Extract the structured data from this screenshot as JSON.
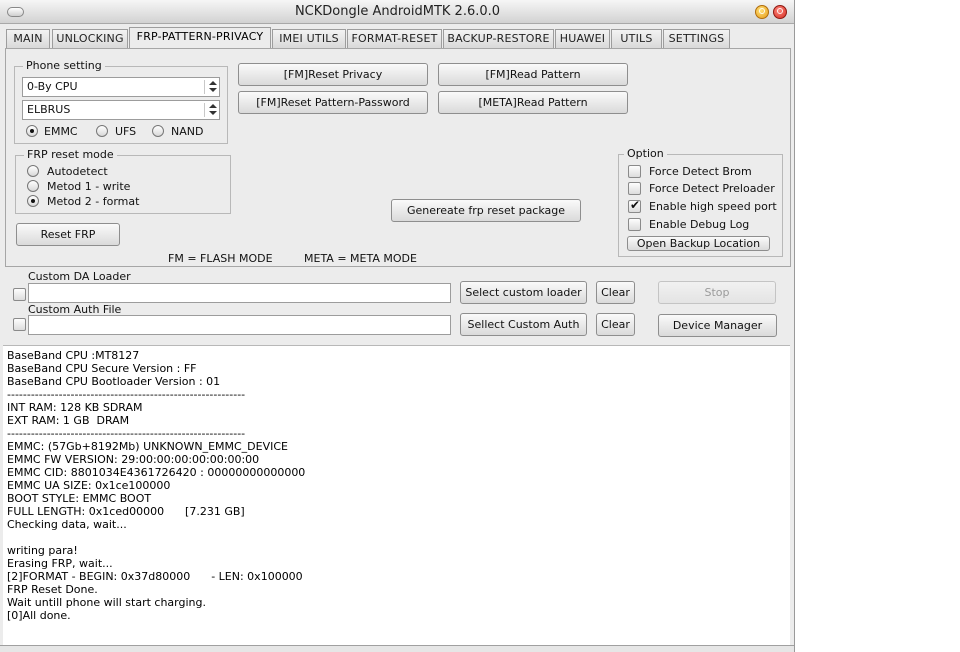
{
  "window": {
    "title": "NCKDongle AndroidMTK 2.6.0.0"
  },
  "tabs": [
    {
      "label": "MAIN"
    },
    {
      "label": "UNLOCKING"
    },
    {
      "label": "FRP-PATTERN-PRIVACY"
    },
    {
      "label": "IMEI UTILS"
    },
    {
      "label": "FORMAT-RESET"
    },
    {
      "label": "BACKUP-RESTORE"
    },
    {
      "label": "HUAWEI"
    },
    {
      "label": "UTILS"
    },
    {
      "label": "SETTINGS"
    }
  ],
  "active_tab": "FRP-PATTERN-PRIVACY",
  "phone_setting": {
    "label": "Phone setting",
    "cpu": "0-By CPU",
    "model": "ELBRUS",
    "storage": [
      {
        "label": "EMMC",
        "selected": true
      },
      {
        "label": "UFS",
        "selected": false
      },
      {
        "label": "NAND",
        "selected": false
      }
    ]
  },
  "frp_mode": {
    "label": "FRP reset mode",
    "options": [
      {
        "label": "Autodetect",
        "selected": false
      },
      {
        "label": "Metod 1 - write",
        "selected": false
      },
      {
        "label": "Metod 2 - format",
        "selected": true
      }
    ]
  },
  "actions": {
    "reset_privacy": "[FM]Reset Privacy",
    "read_pattern_fm": "[FM]Read Pattern",
    "reset_pattern_password": "[FM]Reset Pattern-Password",
    "read_pattern_meta": "[META]Read Pattern",
    "reset_frp": "Reset FRP",
    "generate_package": "Genereate frp reset package"
  },
  "legend": {
    "fm": "FM = FLASH MODE",
    "meta": "META = META MODE"
  },
  "option": {
    "label": "Option",
    "items": [
      {
        "label": "Force Detect Brom",
        "checked": false
      },
      {
        "label": "Force Detect Preloader",
        "checked": false
      },
      {
        "label": "Enable high speed port",
        "checked": true
      },
      {
        "label": "Enable Debug Log",
        "checked": false
      }
    ],
    "open_backup": "Open Backup Location"
  },
  "custom": {
    "da_label": "Custom DA Loader",
    "auth_label": "Custom Auth File",
    "select_loader": "Select custom loader",
    "select_auth": "Sellect Custom Auth",
    "clear": "Clear",
    "stop": "Stop",
    "device_manager": "Device Manager"
  },
  "log": [
    "BaseBand CPU :MT8127",
    "BaseBand CPU Secure Version : FF",
    "BaseBand CPU Bootloader Version : 01",
    "------------------------------------------------------------",
    "INT RAM: 128 KB SDRAM",
    "EXT RAM: 1 GB  DRAM",
    "------------------------------------------------------------",
    "EMMC: (57Gb+8192Mb) UNKNOWN_EMMC_DEVICE",
    "EMMC FW VERSION: 29:00:00:00:00:00:00:00",
    "EMMC CID: 8801034E4361726420 : 00000000000000",
    "EMMC UA SIZE: 0x1ce100000",
    "BOOT STYLE: EMMC BOOT",
    "FULL LENGTH: 0x1ced00000      [7.231 GB]",
    "Checking data, wait...",
    "",
    "writing para!",
    "Erasing FRP, wait...",
    "[2]FORMAT - BEGIN: 0x37d80000      - LEN: 0x100000",
    "FRP Reset Done.",
    "Wait untill phone will start charging.",
    "[0]All done."
  ]
}
